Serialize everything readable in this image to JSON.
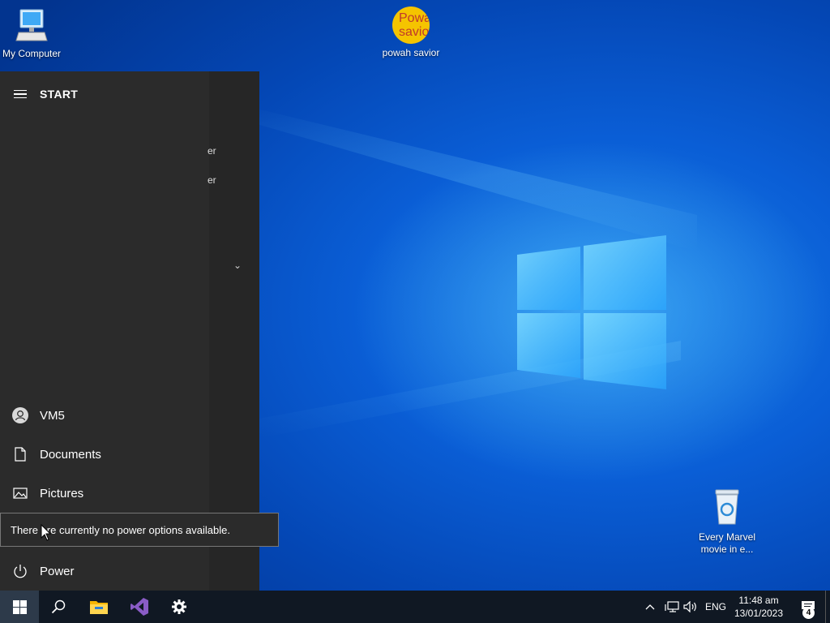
{
  "desktop": {
    "icons": [
      {
        "label": "My Computer"
      },
      {
        "label": "powah savior",
        "image_text": "Powah savior"
      },
      {
        "label": "Every Marvel movie in e..."
      }
    ]
  },
  "start_menu": {
    "title": "START",
    "peek_text_1": "er",
    "peek_text_2": "er",
    "items": [
      {
        "label": "VM5",
        "icon": "user-icon"
      },
      {
        "label": "Documents",
        "icon": "document-icon"
      },
      {
        "label": "Pictures",
        "icon": "pictures-icon"
      },
      {
        "label": "Power",
        "icon": "power-icon"
      }
    ],
    "tooltip": "There are currently no power options available."
  },
  "taskbar": {
    "apps": [
      {
        "name": "start-button"
      },
      {
        "name": "search-icon"
      },
      {
        "name": "file-explorer-icon"
      },
      {
        "name": "visual-studio-icon"
      },
      {
        "name": "settings-icon"
      }
    ],
    "language": "ENG",
    "time": "11:48 am",
    "date": "13/01/2023",
    "notification_count": "4"
  },
  "colors": {
    "accent": "#0a5ed6",
    "start_bg": "#2b2b2b",
    "taskbar_bg": "#101823"
  }
}
